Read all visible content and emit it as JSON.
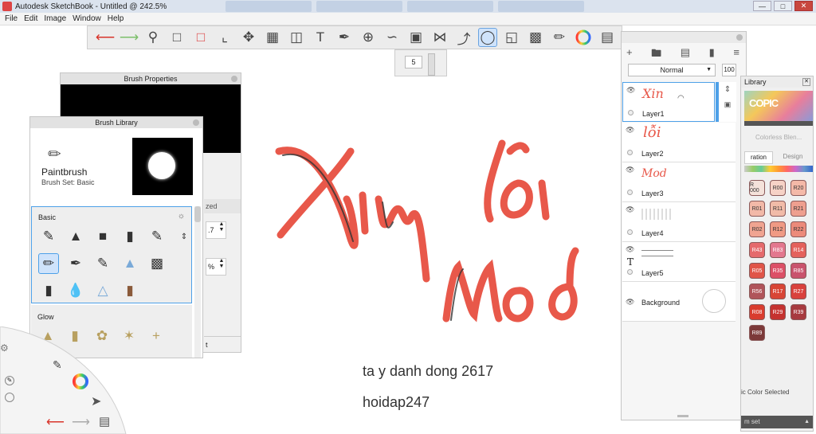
{
  "window": {
    "title": "Autodesk SketchBook - Untitled @ 242.5%"
  },
  "menu": [
    "File",
    "Edit",
    "Image",
    "Window",
    "Help"
  ],
  "toolbar_icons": [
    "undo-icon",
    "redo-icon",
    "zoom-icon",
    "select-rect-icon",
    "select-lasso-icon",
    "crop-icon",
    "transform-icon",
    "distort-icon",
    "perspective-icon",
    "text-icon",
    "ruler-icon",
    "ellipse-guide-icon",
    "curve-icon",
    "perspective-guide-icon",
    "symmetry-icon",
    "stroke-icon",
    "predictive-stroke-icon",
    "shape-icon",
    "copic-icon",
    "brush-library-icon",
    "color-wheel-icon",
    "layers-icon"
  ],
  "brush_size": {
    "value": "5"
  },
  "brush_properties": {
    "title": "Brush Properties",
    "field1": ".7",
    "field2": "%",
    "tab_label": "zed",
    "bottom_label": "t"
  },
  "brush_library": {
    "title": "Brush Library",
    "brush_name": "Paintbrush",
    "brush_set": "Brush Set: Basic",
    "section_basic": "Basic",
    "section_glow": "Glow"
  },
  "canvas": {
    "line1": "ta y danh dong 2617",
    "line2": "hoidap247",
    "art_text1": "Xin",
    "art_text2": "lỗi",
    "art_text3": "Mod"
  },
  "layers": {
    "blend_mode": "Normal",
    "opacity": "100",
    "items": [
      {
        "name": "Layer1",
        "preview": "Xin",
        "selected": true
      },
      {
        "name": "Layer2",
        "preview": "lỗi",
        "selected": false
      },
      {
        "name": "Layer3",
        "preview": "Mod",
        "selected": false
      },
      {
        "name": "Layer4",
        "preview": "",
        "selected": false
      },
      {
        "name": "Layer5",
        "preview": "T",
        "selected": false
      }
    ],
    "background_label": "Background"
  },
  "copic": {
    "title": "Library",
    "brand": "COPIC",
    "colorless": "Colorless Blen...",
    "tab_active": "ration",
    "tab_inactive": "Design",
    "selected_label": "ic Color Selected",
    "bottom": "m set",
    "swatches": [
      {
        "label": "R 000",
        "color": "#f4e2da"
      },
      {
        "label": "R00",
        "color": "#f6d2c6"
      },
      {
        "label": "R20",
        "color": "#f4b9a8"
      },
      {
        "label": "R01",
        "color": "#f2b9a8"
      },
      {
        "label": "R11",
        "color": "#f1bba8"
      },
      {
        "label": "R21",
        "color": "#ee9f8f"
      },
      {
        "label": "R02",
        "color": "#f0a491"
      },
      {
        "label": "R12",
        "color": "#f09a84"
      },
      {
        "label": "R22",
        "color": "#ec8a7a"
      },
      {
        "label": "R43",
        "color": "#e56a6c"
      },
      {
        "label": "R83",
        "color": "#e3778e"
      },
      {
        "label": "R14",
        "color": "#e4615c"
      },
      {
        "label": "R05",
        "color": "#e05548"
      },
      {
        "label": "R35",
        "color": "#dc5067"
      },
      {
        "label": "R85",
        "color": "#c9536d"
      },
      {
        "label": "R56",
        "color": "#b0545a"
      },
      {
        "label": "R17",
        "color": "#d84535"
      },
      {
        "label": "R27",
        "color": "#d9413c"
      },
      {
        "label": "R08",
        "color": "#d93c2e"
      },
      {
        "label": "R29",
        "color": "#c5322f"
      },
      {
        "label": "R39",
        "color": "#a73a3f"
      },
      {
        "label": "R89",
        "color": "#7c3939"
      }
    ]
  },
  "colors": {
    "accent_red": "#e8584a",
    "selection_blue": "#4da0e8"
  }
}
